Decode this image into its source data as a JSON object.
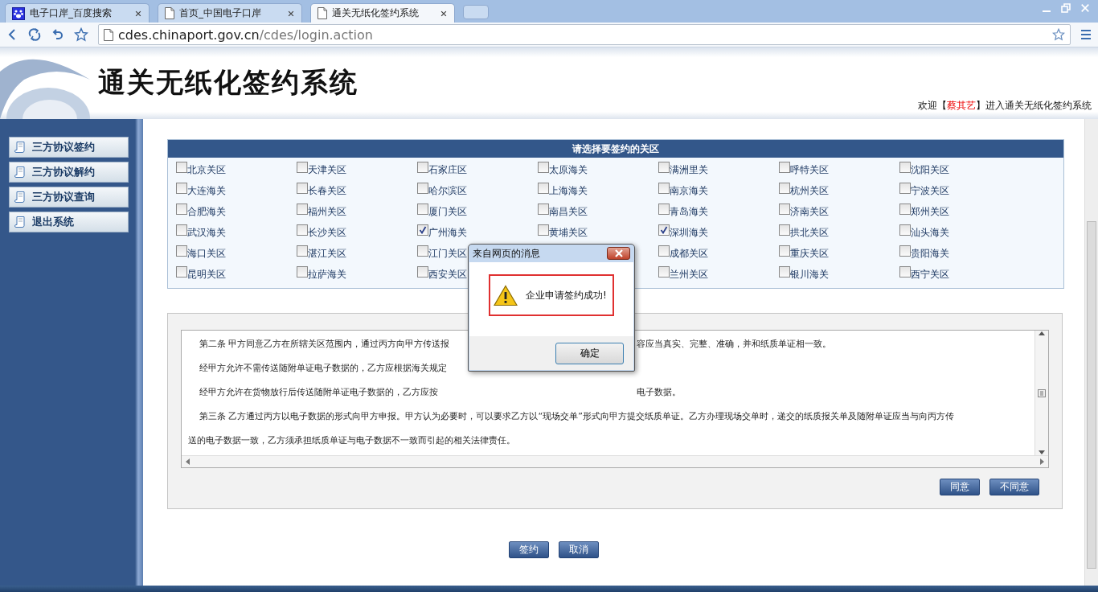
{
  "browser": {
    "tabs": [
      {
        "title": "电子口岸_百度搜索",
        "selected": false,
        "kind": "paw"
      },
      {
        "title": "首页_中国电子口岸",
        "selected": false,
        "kind": "page"
      },
      {
        "title": "通关无纸化签约系统",
        "selected": true,
        "kind": "page"
      }
    ],
    "address": {
      "host": "cdes.chinaport.gov.cn",
      "path": "/cdes/login.action"
    }
  },
  "header": {
    "title": "通关无纸化签约系统",
    "welcome": {
      "prefix": "欢迎【",
      "user": "蔡其艺",
      "suffix": "】进入通关无纸化签约系统"
    }
  },
  "sidebar": {
    "items": [
      "三方协议签约",
      "三方协议解约",
      "三方协议查询",
      "退出系统"
    ]
  },
  "region_panel": {
    "title": "请选择要签约的关区",
    "rows": [
      [
        {
          "label": "北京关区",
          "checked": false
        },
        {
          "label": "天津关区",
          "checked": false
        },
        {
          "label": "石家庄区",
          "checked": false
        },
        {
          "label": "太原海关",
          "checked": false
        },
        {
          "label": "满洲里关",
          "checked": false
        },
        {
          "label": "呼特关区",
          "checked": false
        },
        {
          "label": "沈阳关区",
          "checked": false
        }
      ],
      [
        {
          "label": "大连海关",
          "checked": false
        },
        {
          "label": "长春关区",
          "checked": false
        },
        {
          "label": "哈尔滨区",
          "checked": false
        },
        {
          "label": "上海海关",
          "checked": false
        },
        {
          "label": "南京海关",
          "checked": false
        },
        {
          "label": "杭州关区",
          "checked": false
        },
        {
          "label": "宁波关区",
          "checked": false
        }
      ],
      [
        {
          "label": "合肥海关",
          "checked": false
        },
        {
          "label": "福州关区",
          "checked": false
        },
        {
          "label": "厦门关区",
          "checked": false
        },
        {
          "label": "南昌关区",
          "checked": false
        },
        {
          "label": "青岛海关",
          "checked": false
        },
        {
          "label": "济南关区",
          "checked": false
        },
        {
          "label": "郑州关区",
          "checked": false
        }
      ],
      [
        {
          "label": "武汉海关",
          "checked": false
        },
        {
          "label": "长沙关区",
          "checked": false
        },
        {
          "label": "广州海关",
          "checked": true
        },
        {
          "label": "黄埔关区",
          "checked": false
        },
        {
          "label": "深圳海关",
          "checked": true
        },
        {
          "label": "拱北关区",
          "checked": false
        },
        {
          "label": "汕头海关",
          "checked": false
        }
      ],
      [
        {
          "label": "海口关区",
          "checked": false
        },
        {
          "label": "湛江关区",
          "checked": false
        },
        {
          "label": "江门关区",
          "checked": false
        },
        {
          "covered": true
        },
        {
          "label": "成都关区",
          "checked": false
        },
        {
          "label": "重庆关区",
          "checked": false
        },
        {
          "label": "贵阳海关",
          "checked": false
        }
      ],
      [
        {
          "label": "昆明关区",
          "checked": false
        },
        {
          "label": "拉萨海关",
          "checked": false
        },
        {
          "label": "西安关区",
          "checked": false
        },
        {
          "covered": true
        },
        {
          "label": "兰州关区",
          "checked": false
        },
        {
          "label": "银川海关",
          "checked": false
        },
        {
          "label": "西宁关区",
          "checked": false
        }
      ]
    ]
  },
  "agreement": {
    "lines": [
      {
        "indent": true,
        "left": "第二条 甲方同意乙方在所辖关区范围内，通过丙方向甲方传送报",
        "right": "容应当真实、完整、准确，并和纸质单证相一致。"
      },
      {
        "indent": true,
        "left": "经甲方允许不需传送随附单证电子数据的，乙方应根据海关规定"
      },
      {
        "indent": true,
        "left": "经甲方允许在货物放行后传送随附单证电子数据的，乙方应按",
        "right": "电子数据。"
      },
      {
        "indent": true,
        "full": "第三条 乙方通过丙方以电子数据的形式向甲方申报。甲方认为必要时，可以要求乙方以“现场交单”形式向甲方提交纸质单证。乙方办理现场交单时，递交的纸质报关单及随附单证应当与向丙方传"
      },
      {
        "indent": false,
        "full": "送的电子数据一致，乙方须承担纸质单证与电子数据不一致而引起的相关法律责任。"
      }
    ],
    "buttons": [
      "同意",
      "不同意"
    ]
  },
  "actions": [
    "签约",
    "取消"
  ],
  "dialog": {
    "title": "来自网页的消息",
    "message": "企业申请签约成功!",
    "button": "确定"
  }
}
